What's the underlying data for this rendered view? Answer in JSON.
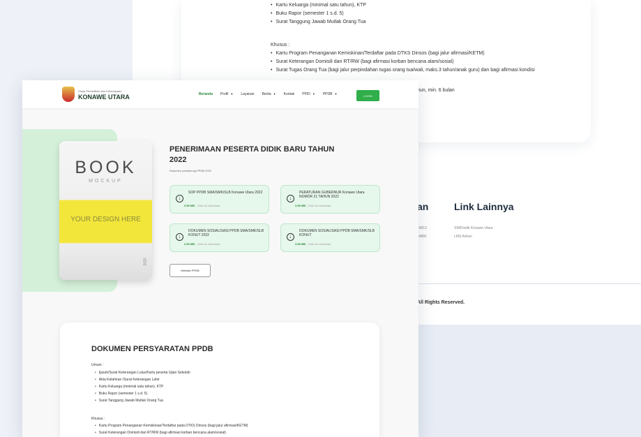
{
  "back": {
    "umum_tail": [
      "Kartu Keluarga (minimal satu tahun), KTP",
      "Buku Rapor (semester 1 s.d. 5)",
      "Surat Tanggung Jawab Mutlak Orang Tua"
    ],
    "khusus_label": "Khusus :",
    "khusus": [
      "Kartu Program Penanganan Kemiskinan/Terdaftar pada DTKS Dinsos (bagi jalur afirmasi/KETM)",
      "Surat Keterangan Domisili dari RT/RW (bagi afirmasi korban bencana alam/sosial)",
      "Surat Tugas Orang Tua (bagi jalur perpindahan tugas orang tua/wali, maks.3 tahun/anak guru) dan bagi afirmasi kondisi"
    ],
    "tail_text": "hun, min. 6 bulan",
    "footer_col1_partial": "an",
    "footer_phone_1": "54813",
    "footer_phone_2": "54881",
    "links_title": "Link Lainnya",
    "links": [
      "SIMDisdik Konawe Utara",
      "LMS Arikari"
    ],
    "rights": "All Rights Reserved."
  },
  "nav": {
    "org_small": "Dinas Pendidikan dan Kebudayaan",
    "org_big": "KONAWE UTARA",
    "items": [
      {
        "label": "Beranda",
        "dropdown": false
      },
      {
        "label": "Profil",
        "dropdown": true
      },
      {
        "label": "Layanan",
        "dropdown": false
      },
      {
        "label": "Berita",
        "dropdown": true
      },
      {
        "label": "Kontak",
        "dropdown": false
      },
      {
        "label": "PPID",
        "dropdown": true
      },
      {
        "label": "PPDB",
        "dropdown": true
      }
    ],
    "login": "LOGIN"
  },
  "book": {
    "title": "BOOK",
    "subtitle": "MOCKUP",
    "design": "YOUR DESIGN HERE",
    "year": "2020"
  },
  "hero": {
    "title": "PENERIMAAN PESERTA DIDIK BARU TAHUN 2022",
    "subtitle": "Dokumen pendukung PPDB 2022",
    "docs": [
      {
        "title": "SOP PPDB SMA/SMK/SLB Konawe Utara 2022",
        "size": "3.59 MB",
        "hint": " - Click for download"
      },
      {
        "title": "PERATURAN GUBERNUR Konawe Utara NOMOR 21 TAHUN 2022",
        "size": "3.59 MB",
        "hint": " - Click for download"
      },
      {
        "title": "DOKUMEN SOSIALISASI PPDB SMA/SMK/SLB KONUT 2022",
        "size": "3.59 MB",
        "hint": " - Click for download"
      },
      {
        "title": "DOKUMEN SOSIALISASI PPDB SMA/SMK/SLB KONUT",
        "size": "3.59 MB",
        "hint": " - Click for download"
      }
    ],
    "website_btn": "Website PPDB"
  },
  "requirements": {
    "title": "DOKUMEN PERSYARATAN PPDB",
    "umum_label": "Umum :",
    "umum": [
      "Ijazah/Surat Keterangan Lulus/Kartu peserta Ujian Sekolah",
      "Akta Kelahiran /Surat Keterangan Lahir",
      "Kartu Keluarga (minimal satu tahun), KTP",
      "Buku Rapor (semester 1 s.d. 5)",
      "Surat Tanggung Jawab Mutlak Orang Tua"
    ],
    "khusus_label": "Khusus :",
    "khusus": [
      "Kartu Program Penanganan Kemiskinan/Terdaftar pada DTKS Dinsos (bagi jalur afirmasi/KETM)",
      "Surat Keterangan Domisili dari RT/RW (bagi afirmasi korban bencana alam/sosial)"
    ]
  }
}
